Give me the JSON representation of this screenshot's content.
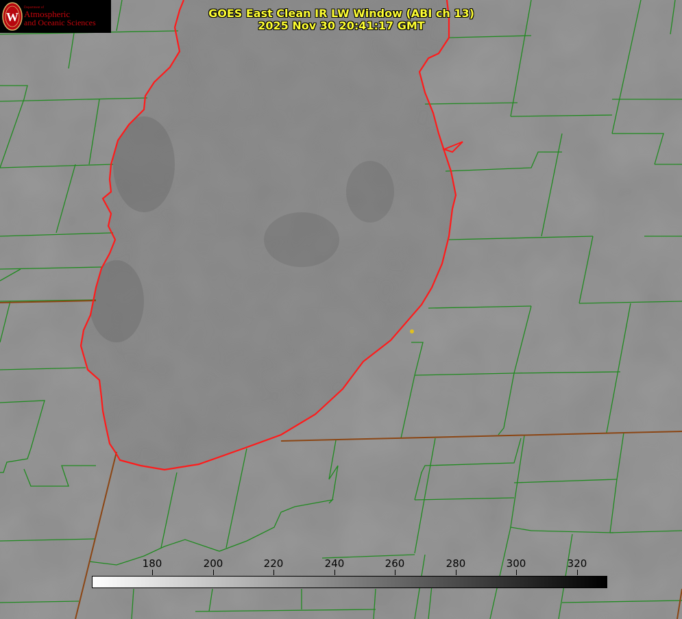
{
  "title": {
    "line1": "GOES East Clean IR LW Window (ABI ch 13)",
    "line2": "2025 Nov 30 20:41:17 GMT",
    "color": "#ffff33"
  },
  "logo": {
    "department": "Department of",
    "line1": "Atmospheric",
    "line2": "and Oceanic Sciences",
    "seal_letter": "W",
    "text_color": "#c5050c",
    "seal_color": "#b7070f"
  },
  "map": {
    "satellite": "GOES East",
    "channel": "ABI ch 13",
    "background_color": "#8a8a8a",
    "county_border_color": "#1f8a1f",
    "state_border_color": "#8b4513",
    "coastline_color": "#ff1a1a",
    "marker_color": "#e0c020"
  },
  "colorbar": {
    "range": [
      160,
      330
    ],
    "ticks": [
      "180",
      "200",
      "220",
      "240",
      "260",
      "280",
      "300",
      "320"
    ],
    "gradient_from": "#ffffff",
    "gradient_to": "#000000"
  }
}
